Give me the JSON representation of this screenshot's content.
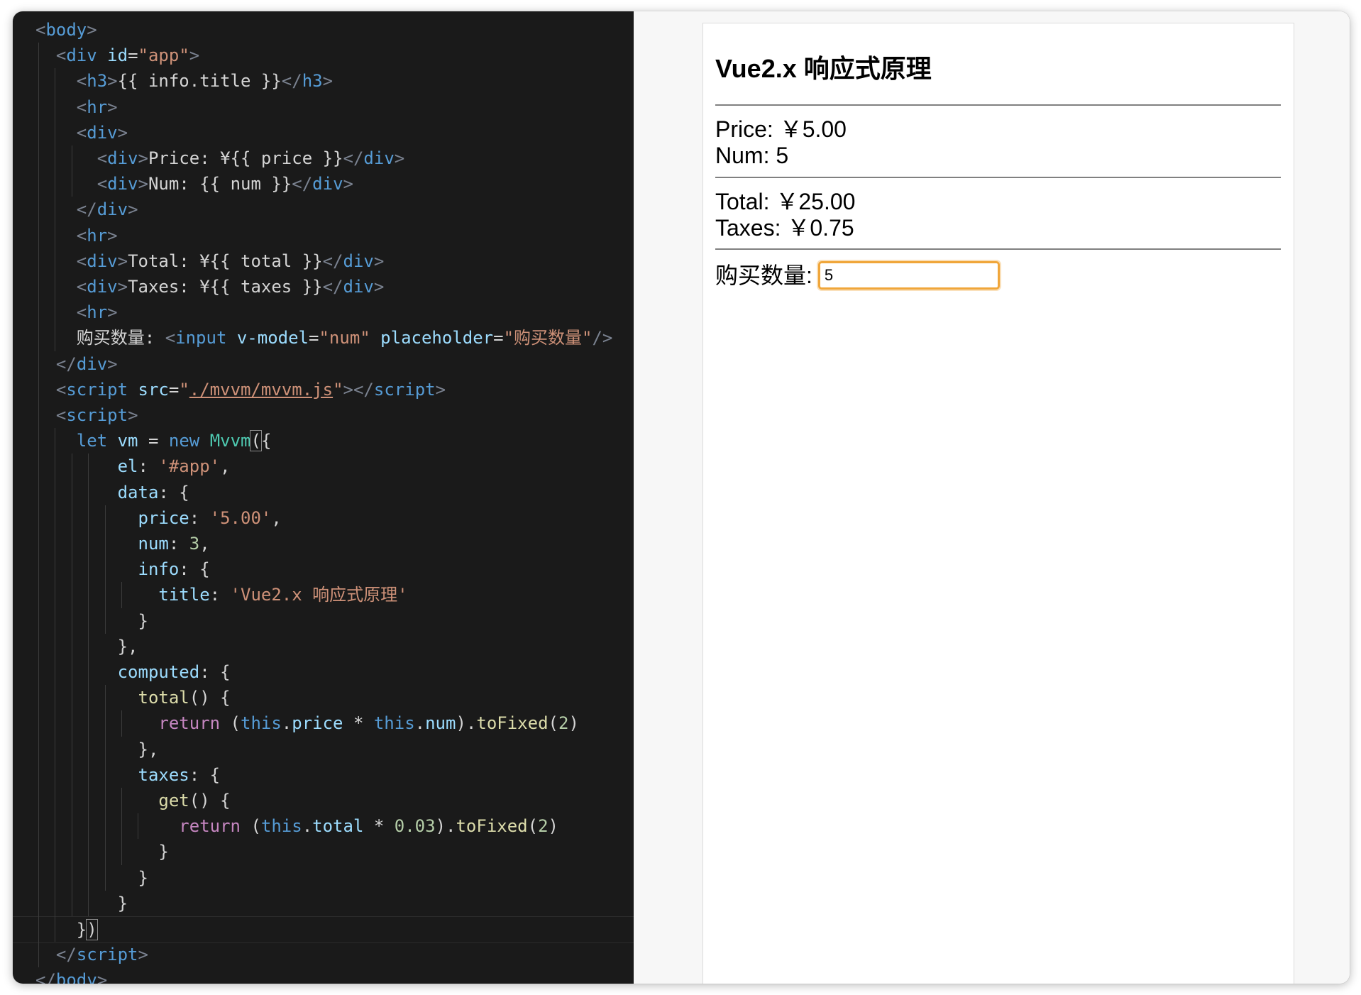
{
  "editor": {
    "lines": [
      [
        [
          "t",
          "<"
        ],
        [
          "n",
          "body"
        ],
        [
          "t",
          ">"
        ]
      ],
      [
        [
          "w",
          "  "
        ],
        [
          "t",
          "<"
        ],
        [
          "n",
          "div"
        ],
        [
          "w",
          " "
        ],
        [
          "a",
          "id"
        ],
        [
          "x",
          "="
        ],
        [
          "s",
          "\"app\""
        ],
        [
          "t",
          ">"
        ]
      ],
      [
        [
          "w",
          "    "
        ],
        [
          "t",
          "<"
        ],
        [
          "n",
          "h3"
        ],
        [
          "t",
          ">"
        ],
        [
          "x",
          "{{ info.title }}"
        ],
        [
          "t",
          "</"
        ],
        [
          "n",
          "h3"
        ],
        [
          "t",
          ">"
        ]
      ],
      [
        [
          "w",
          "    "
        ],
        [
          "t",
          "<"
        ],
        [
          "n",
          "hr"
        ],
        [
          "t",
          ">"
        ]
      ],
      [
        [
          "w",
          "    "
        ],
        [
          "t",
          "<"
        ],
        [
          "n",
          "div"
        ],
        [
          "t",
          ">"
        ]
      ],
      [
        [
          "w",
          "      "
        ],
        [
          "t",
          "<"
        ],
        [
          "n",
          "div"
        ],
        [
          "t",
          ">"
        ],
        [
          "x",
          "Price: ¥{{ price }}"
        ],
        [
          "t",
          "</"
        ],
        [
          "n",
          "div"
        ],
        [
          "t",
          ">"
        ]
      ],
      [
        [
          "w",
          "      "
        ],
        [
          "t",
          "<"
        ],
        [
          "n",
          "div"
        ],
        [
          "t",
          ">"
        ],
        [
          "x",
          "Num: {{ num }}"
        ],
        [
          "t",
          "</"
        ],
        [
          "n",
          "div"
        ],
        [
          "t",
          ">"
        ]
      ],
      [
        [
          "w",
          "    "
        ],
        [
          "t",
          "</"
        ],
        [
          "n",
          "div"
        ],
        [
          "t",
          ">"
        ]
      ],
      [
        [
          "w",
          "    "
        ],
        [
          "t",
          "<"
        ],
        [
          "n",
          "hr"
        ],
        [
          "t",
          ">"
        ]
      ],
      [
        [
          "w",
          "    "
        ],
        [
          "t",
          "<"
        ],
        [
          "n",
          "div"
        ],
        [
          "t",
          ">"
        ],
        [
          "x",
          "Total: ¥{{ total }}"
        ],
        [
          "t",
          "</"
        ],
        [
          "n",
          "div"
        ],
        [
          "t",
          ">"
        ]
      ],
      [
        [
          "w",
          "    "
        ],
        [
          "t",
          "<"
        ],
        [
          "n",
          "div"
        ],
        [
          "t",
          ">"
        ],
        [
          "x",
          "Taxes: ¥{{ taxes }}"
        ],
        [
          "t",
          "</"
        ],
        [
          "n",
          "div"
        ],
        [
          "t",
          ">"
        ]
      ],
      [
        [
          "w",
          "    "
        ],
        [
          "t",
          "<"
        ],
        [
          "n",
          "hr"
        ],
        [
          "t",
          ">"
        ]
      ],
      [
        [
          "w",
          "    "
        ],
        [
          "x",
          "购买数量: "
        ],
        [
          "t",
          "<"
        ],
        [
          "n",
          "input"
        ],
        [
          "w",
          " "
        ],
        [
          "a",
          "v-model"
        ],
        [
          "x",
          "="
        ],
        [
          "s",
          "\"num\""
        ],
        [
          "w",
          " "
        ],
        [
          "a",
          "placeholder"
        ],
        [
          "x",
          "="
        ],
        [
          "s",
          "\"购买数量\""
        ],
        [
          "t",
          "/>"
        ]
      ],
      [
        [
          "w",
          "  "
        ],
        [
          "t",
          "</"
        ],
        [
          "n",
          "div"
        ],
        [
          "t",
          ">"
        ]
      ],
      [
        [
          "w",
          "  "
        ],
        [
          "t",
          "<"
        ],
        [
          "n",
          "script"
        ],
        [
          "w",
          " "
        ],
        [
          "a",
          "src"
        ],
        [
          "x",
          "="
        ],
        [
          "s",
          "\""
        ],
        [
          "sl",
          "./mvvm/mvvm.js"
        ],
        [
          "s",
          "\""
        ],
        [
          "t",
          "></"
        ],
        [
          "n",
          "script"
        ],
        [
          "t",
          ">"
        ]
      ],
      [
        [
          "w",
          "  "
        ],
        [
          "t",
          "<"
        ],
        [
          "n",
          "script"
        ],
        [
          "t",
          ">"
        ]
      ],
      [
        [
          "w",
          "    "
        ],
        [
          "k",
          "let"
        ],
        [
          "w",
          " "
        ],
        [
          "p",
          "vm"
        ],
        [
          "x",
          " = "
        ],
        [
          "k",
          "new"
        ],
        [
          "w",
          " "
        ],
        [
          "c",
          "Mvvm"
        ],
        [
          "cb",
          "("
        ],
        [
          "x",
          "{"
        ]
      ],
      [
        [
          "w",
          "        "
        ],
        [
          "p",
          "el"
        ],
        [
          "x",
          ": "
        ],
        [
          "s",
          "'#app'"
        ],
        [
          "x",
          ","
        ]
      ],
      [
        [
          "w",
          "        "
        ],
        [
          "p",
          "data"
        ],
        [
          "x",
          ": {"
        ]
      ],
      [
        [
          "w",
          "          "
        ],
        [
          "p",
          "price"
        ],
        [
          "x",
          ": "
        ],
        [
          "s",
          "'5.00'"
        ],
        [
          "x",
          ","
        ]
      ],
      [
        [
          "w",
          "          "
        ],
        [
          "p",
          "num"
        ],
        [
          "x",
          ": "
        ],
        [
          "m",
          "3"
        ],
        [
          "x",
          ","
        ]
      ],
      [
        [
          "w",
          "          "
        ],
        [
          "p",
          "info"
        ],
        [
          "x",
          ": {"
        ]
      ],
      [
        [
          "w",
          "            "
        ],
        [
          "p",
          "title"
        ],
        [
          "x",
          ": "
        ],
        [
          "s",
          "'Vue2.x 响应式原理'"
        ]
      ],
      [
        [
          "w",
          "          "
        ],
        [
          "x",
          "}"
        ]
      ],
      [
        [
          "w",
          "        "
        ],
        [
          "x",
          "},"
        ]
      ],
      [
        [
          "w",
          "        "
        ],
        [
          "p",
          "computed"
        ],
        [
          "x",
          ": {"
        ]
      ],
      [
        [
          "w",
          "          "
        ],
        [
          "f",
          "total"
        ],
        [
          "x",
          "() {"
        ]
      ],
      [
        [
          "w",
          "            "
        ],
        [
          "r",
          "return"
        ],
        [
          "x",
          " ("
        ],
        [
          "k",
          "this"
        ],
        [
          "x",
          "."
        ],
        [
          "p",
          "price"
        ],
        [
          "x",
          " * "
        ],
        [
          "k",
          "this"
        ],
        [
          "x",
          "."
        ],
        [
          "p",
          "num"
        ],
        [
          "x",
          ")."
        ],
        [
          "f",
          "toFixed"
        ],
        [
          "x",
          "("
        ],
        [
          "m",
          "2"
        ],
        [
          "x",
          ")"
        ]
      ],
      [
        [
          "w",
          "          "
        ],
        [
          "x",
          "},"
        ]
      ],
      [
        [
          "w",
          "          "
        ],
        [
          "p",
          "taxes"
        ],
        [
          "x",
          ": {"
        ]
      ],
      [
        [
          "w",
          "            "
        ],
        [
          "f",
          "get"
        ],
        [
          "x",
          "() {"
        ]
      ],
      [
        [
          "w",
          "              "
        ],
        [
          "r",
          "return"
        ],
        [
          "x",
          " ("
        ],
        [
          "k",
          "this"
        ],
        [
          "x",
          "."
        ],
        [
          "p",
          "total"
        ],
        [
          "x",
          " * "
        ],
        [
          "m",
          "0.03"
        ],
        [
          "x",
          ")."
        ],
        [
          "f",
          "toFixed"
        ],
        [
          "x",
          "("
        ],
        [
          "m",
          "2"
        ],
        [
          "x",
          ")"
        ]
      ],
      [
        [
          "w",
          "            "
        ],
        [
          "x",
          "}"
        ]
      ],
      [
        [
          "w",
          "          "
        ],
        [
          "x",
          "}"
        ]
      ],
      [
        [
          "w",
          "        "
        ],
        [
          "x",
          "}"
        ]
      ],
      [
        [
          "w",
          "    "
        ],
        [
          "x",
          "}"
        ],
        [
          "cb",
          ")"
        ]
      ],
      [
        [
          "w",
          "  "
        ],
        [
          "t",
          "</"
        ],
        [
          "n",
          "script"
        ],
        [
          "t",
          ">"
        ]
      ],
      [
        [
          "t",
          "</"
        ],
        [
          "n",
          "body"
        ],
        [
          "t",
          ">"
        ]
      ]
    ],
    "current_line_index": 35
  },
  "preview": {
    "title": "Vue2.x 响应式原理",
    "price": "Price: ￥5.00",
    "num": "Num: 5",
    "total": "Total: ￥25.00",
    "taxes": "Taxes: ￥0.75",
    "qty_label": "购买数量:",
    "qty_value": "5",
    "qty_placeholder": "购买数量"
  },
  "colors": {
    "editor_bg": "#1a1a1a",
    "focus_outline": "#f0a63a"
  }
}
